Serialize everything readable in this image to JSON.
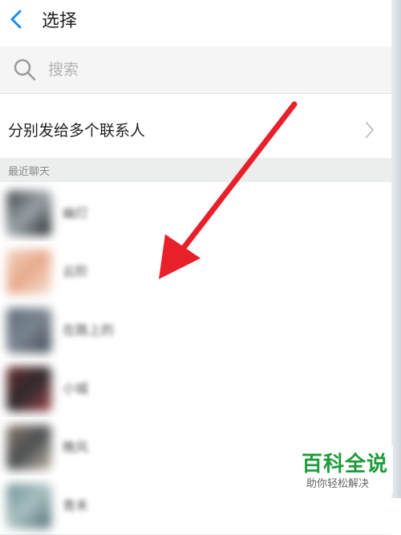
{
  "header": {
    "title": "选择",
    "back_icon": "chevron-left-icon"
  },
  "search": {
    "placeholder": "搜索"
  },
  "multi_send": {
    "label": "分别发给多个联系人"
  },
  "section": {
    "title": "最近聊天"
  },
  "chats": [
    {
      "name": "幽灯",
      "avatar_colors": [
        "#3a3f44",
        "#9aa3a8",
        "#1d2226"
      ]
    },
    {
      "name": "云阶",
      "avatar_colors": [
        "#f1d3c0",
        "#e8a98c",
        "#f7e4d6"
      ]
    },
    {
      "name": "在路上的",
      "avatar_colors": [
        "#5c6a78",
        "#7a8590",
        "#3e4a55"
      ]
    },
    {
      "name": "小城",
      "avatar_colors": [
        "#6b2a2e",
        "#2d2a2c",
        "#a3474d"
      ]
    },
    {
      "name": "晚风",
      "avatar_colors": [
        "#8c7a6a",
        "#4a4e52",
        "#c7b8a6"
      ]
    },
    {
      "name": "青禾",
      "avatar_colors": [
        "#6f8f93",
        "#a9c0c1",
        "#4d6b70"
      ]
    }
  ],
  "colors": {
    "back_icon": "#1a8cf0",
    "annotation_arrow": "#e8202a",
    "watermark": "#1e9c3a"
  },
  "watermark": {
    "title": "百科全说",
    "subtitle": "助你轻松解决"
  }
}
